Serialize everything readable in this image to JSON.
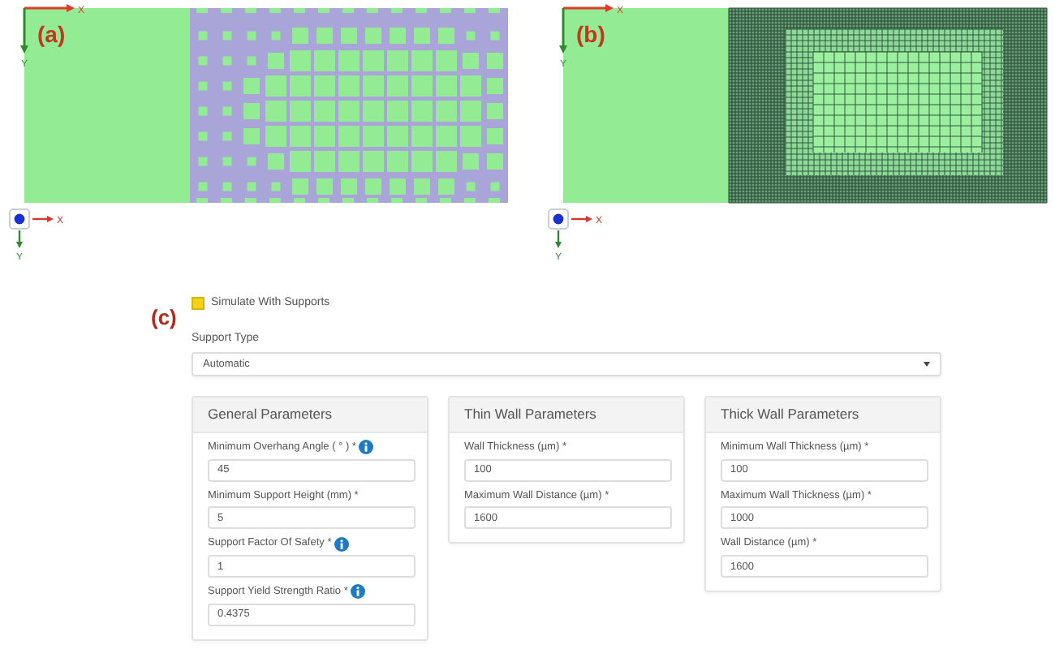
{
  "views": [
    {
      "label": "(a)",
      "kind": "support",
      "axis_labels": [
        "X",
        "Y"
      ],
      "triad_labels": [
        "X",
        "Y"
      ]
    },
    {
      "label": "(b)",
      "kind": "mesh",
      "axis_labels": [
        "X",
        "Y"
      ],
      "triad_labels": [
        "X",
        "Y"
      ]
    }
  ],
  "settings": {
    "label": "(c)",
    "simulate_supports": {
      "label": "Simulate With Supports",
      "checked": true
    },
    "support_type": {
      "label": "Support Type",
      "value": "Automatic"
    },
    "panels": [
      {
        "title": "General Parameters",
        "fields": [
          {
            "label": "Minimum Overhang Angle ( ° ) *",
            "info": true,
            "value": "45"
          },
          {
            "label": "Minimum Support Height (mm) *",
            "info": false,
            "value": "5"
          },
          {
            "label": "Support Factor Of Safety *",
            "info": true,
            "value": "1"
          },
          {
            "label": "Support Yield Strength Ratio *",
            "info": true,
            "value": "0.4375"
          }
        ]
      },
      {
        "title": "Thin Wall Parameters",
        "fields": [
          {
            "label": "Wall Thickness (µm) *",
            "info": false,
            "value": "100"
          },
          {
            "label": "Maximum Wall Distance (µm) *",
            "info": false,
            "value": "1600"
          }
        ]
      },
      {
        "title": "Thick Wall Parameters",
        "fields": [
          {
            "label": "Minimum Wall Thickness (µm) *",
            "info": false,
            "value": "100"
          },
          {
            "label": "Maximum Wall Thickness (µm) *",
            "info": false,
            "value": "1000"
          },
          {
            "label": "Wall Distance (µm) *",
            "info": false,
            "value": "1600"
          }
        ]
      }
    ]
  }
}
